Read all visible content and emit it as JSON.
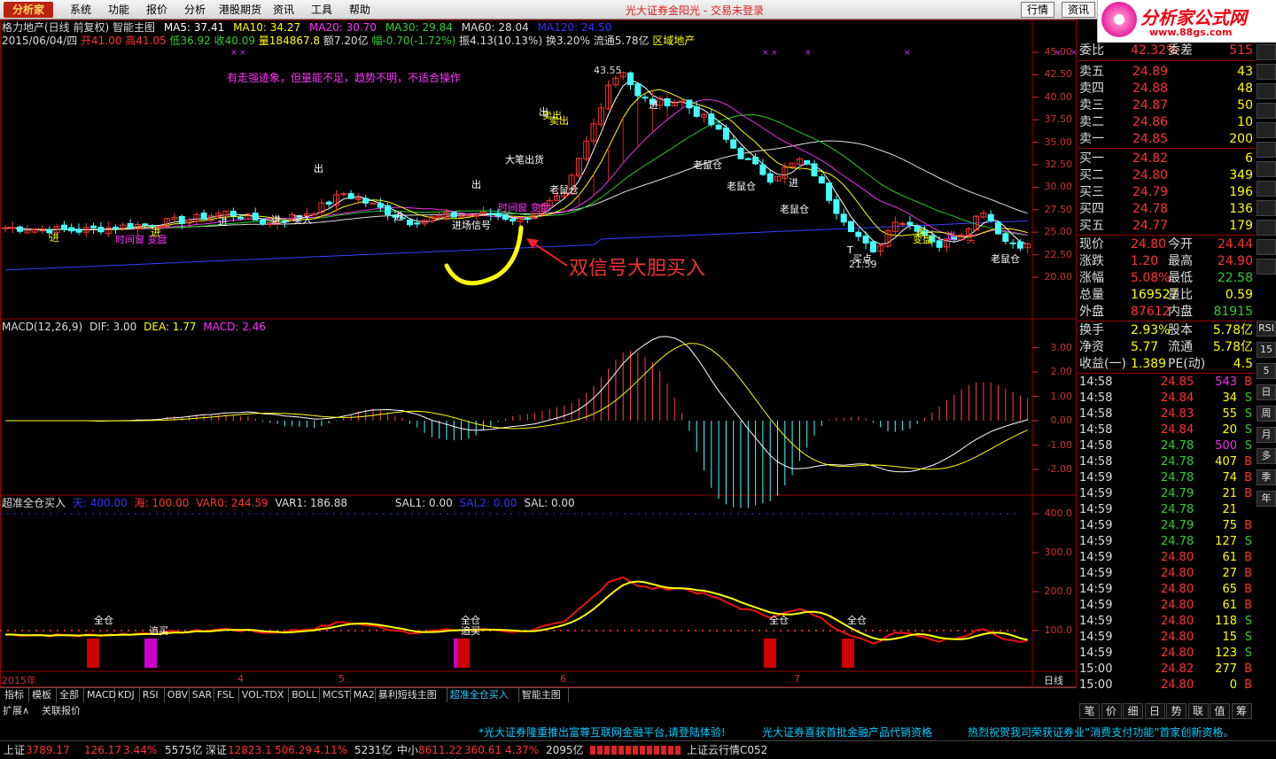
{
  "app": {
    "logo_text": "分析家",
    "title": "光大证券金阳光 - 交易未登录"
  },
  "menu": [
    "系统",
    "功能",
    "报价",
    "分析",
    "港股期货",
    "资讯",
    "工具",
    "帮助"
  ],
  "top_buttons": {
    "quote": "行情",
    "info": "资讯"
  },
  "ad": {
    "title": "分析家公式网",
    "url": "www.88gs.com"
  },
  "header": {
    "line1": {
      "stock": "格力地产(日线 前复权) 智能主图",
      "ma5": "MA5: 37.41",
      "ma10": "MA10: 34.27",
      "ma20": "MA20: 30.70",
      "ma30": "MA30: 29.84",
      "ma60": "MA60: 28.04",
      "ma120": "MA120: 24.50"
    },
    "line2": {
      "date": "2015/06/04/四",
      "open": "开41.00",
      "high": "高41.05",
      "low": "低36.92",
      "close": "收40.09",
      "vol": "量184867.8",
      "amt": "额7.20亿",
      "chg": "幅-0.70(-1.72%)",
      "amp": "振4.13(10.13%)",
      "turn": "换3.20%",
      "float": "流通5.78亿",
      "sector": "区域地产"
    }
  },
  "annotations": {
    "hint": "有走强迹象，但量能不足，趋势不明，不适合操作",
    "big": "双信号大胆买入",
    "high_price": "43.55",
    "low_price": "21.59",
    "labels": [
      "进",
      "时间窗 变盘",
      "进",
      "买入",
      "出",
      "进",
      "进",
      "进",
      "进场信号",
      "时间窗 变盘",
      "出",
      "大笔出货",
      "卖出",
      "出",
      "进",
      "老鼠仓",
      "老鼠仓",
      "老鼠仓",
      "老鼠仓",
      "买点",
      "进",
      "进",
      "变盘",
      "买",
      "老鼠仓",
      "卖出",
      "进",
      "T"
    ]
  },
  "price_axis": [
    "45.00",
    "42.50",
    "40.00",
    "37.50",
    "35.00",
    "32.50",
    "30.00",
    "27.50",
    "25.00",
    "22.50",
    "20.00"
  ],
  "macd": {
    "title": "MACD(12,26,9)",
    "dif": "DIF: 3.00",
    "dea": "DEA: 1.77",
    "macd": "MACD: 2.46",
    "axis": [
      "3.00",
      "2.00",
      "1.00",
      "0.00",
      "-1.00",
      "-2.00"
    ]
  },
  "ind3": {
    "title": "超准全仓买入",
    "tian": "天: 400.00",
    "hai": "海: 100.00",
    "var0": "VAR0: 244.59",
    "var1": "VAR1: 186.88",
    "sal1": "SAL1: 0.00",
    "sal2": "SAL2: 0.00",
    "sal": "SAL: 0.00",
    "axis": [
      "400.0",
      "300.0",
      "200.0",
      "100.0"
    ],
    "marks": [
      "全仓",
      "追买",
      "全仓",
      "追买",
      "全仓",
      "全仓"
    ]
  },
  "date_axis": {
    "year": "2015年",
    "months": [
      "4",
      "5",
      "6",
      "7"
    ],
    "period": "日线"
  },
  "panel": {
    "weibi": {
      "label": "委比",
      "value": "42.32%",
      "label2": "委差",
      "value2": "515"
    },
    "sells": [
      {
        "label": "卖五",
        "price": "24.89",
        "vol": "43"
      },
      {
        "label": "卖四",
        "price": "24.88",
        "vol": "48"
      },
      {
        "label": "卖三",
        "price": "24.87",
        "vol": "50"
      },
      {
        "label": "卖二",
        "price": "24.86",
        "vol": "10"
      },
      {
        "label": "卖一",
        "price": "24.85",
        "vol": "200"
      }
    ],
    "buys": [
      {
        "label": "买一",
        "price": "24.82",
        "vol": "6"
      },
      {
        "label": "买二",
        "price": "24.80",
        "vol": "349"
      },
      {
        "label": "买三",
        "price": "24.79",
        "vol": "196"
      },
      {
        "label": "买四",
        "price": "24.78",
        "vol": "136"
      },
      {
        "label": "买五",
        "price": "24.77",
        "vol": "179"
      }
    ],
    "stats": [
      {
        "l1": "现价",
        "v1": "24.80",
        "l2": "今开",
        "v2": "24.44"
      },
      {
        "l1": "涨跌",
        "v1": "1.20",
        "l2": "最高",
        "v2": "24.90"
      },
      {
        "l1": "涨幅",
        "v1": "5.08%",
        "l2": "最低",
        "v2": "22.58"
      },
      {
        "l1": "总量",
        "v1": "169527",
        "l2": "量比",
        "v2": "0.59"
      },
      {
        "l1": "外盘",
        "v1": "87612",
        "l2": "内盘",
        "v2": "81915"
      }
    ],
    "stats2": [
      {
        "l1": "换手",
        "v1": "2.93%",
        "l2": "股本",
        "v2": "5.78亿"
      },
      {
        "l1": "净资",
        "v1": "5.77",
        "l2": "流通",
        "v2": "5.78亿"
      },
      {
        "l1": "收益(一)",
        "v1": "1.389",
        "l2": "PE(动)",
        "v2": "4.5"
      }
    ],
    "ticks": [
      {
        "t": "14:58",
        "p": "24.85",
        "v": "543",
        "s": "B"
      },
      {
        "t": "14:58",
        "p": "24.84",
        "v": "34",
        "s": "S"
      },
      {
        "t": "14:58",
        "p": "24.83",
        "v": "55",
        "s": "S"
      },
      {
        "t": "14:58",
        "p": "24.84",
        "v": "20",
        "s": "S"
      },
      {
        "t": "14:58",
        "p": "24.78",
        "v": "500",
        "s": "S"
      },
      {
        "t": "14:58",
        "p": "24.78",
        "v": "407",
        "s": "B"
      },
      {
        "t": "14:59",
        "p": "24.78",
        "v": "74",
        "s": "B"
      },
      {
        "t": "14:59",
        "p": "24.79",
        "v": "21",
        "s": "B"
      },
      {
        "t": "14:59",
        "p": "24.78",
        "v": "21",
        "s": ""
      },
      {
        "t": "14:59",
        "p": "24.79",
        "v": "75",
        "s": "B"
      },
      {
        "t": "14:59",
        "p": "24.78",
        "v": "127",
        "s": "S"
      },
      {
        "t": "14:59",
        "p": "24.80",
        "v": "61",
        "s": "B"
      },
      {
        "t": "14:59",
        "p": "24.80",
        "v": "27",
        "s": "B"
      },
      {
        "t": "14:59",
        "p": "24.80",
        "v": "65",
        "s": "B"
      },
      {
        "t": "14:59",
        "p": "24.80",
        "v": "61",
        "s": "B"
      },
      {
        "t": "14:59",
        "p": "24.80",
        "v": "118",
        "s": "S"
      },
      {
        "t": "14:59",
        "p": "24.80",
        "v": "15",
        "s": "S"
      },
      {
        "t": "14:59",
        "p": "24.80",
        "v": "123",
        "s": "S"
      },
      {
        "t": "15:00",
        "p": "24.82",
        "v": "277",
        "s": "B"
      },
      {
        "t": "15:00",
        "p": "24.80",
        "v": "0",
        "s": "B"
      }
    ],
    "bottom_tabs": [
      "笔",
      "价",
      "细",
      "日",
      "势",
      "联",
      "值",
      "筹"
    ]
  },
  "side_buttons": [
    "RSI",
    "15",
    "5",
    "日",
    "周",
    "月",
    "多",
    "季",
    "年"
  ],
  "tabs": [
    "指标",
    "模板",
    "全部",
    "MACD",
    "KDJ",
    "RSI",
    "OBV",
    "SAR",
    "FSL",
    "VOL-TDX",
    "BOLL",
    "MCST",
    "MA2",
    "暴利短线主图",
    "超准全仓买入",
    "智能主图"
  ],
  "row2": [
    "扩展∧",
    "关联报价"
  ],
  "ticker": [
    "*光大证券隆重推出富尊互联网金融平台,请登陆体验!",
    "光大证券喜获首批金融产品代销资格",
    "热烈祝贺我司荣获证券业“消费支付功能”首家创新资格。"
  ],
  "status": {
    "sh": {
      "name": "上证",
      "v": "3789.17",
      "c": "126.17",
      "p": "3.44%",
      "a": "5575亿"
    },
    "sz": {
      "name": "深证",
      "v": "12823.1",
      "c": "506.29",
      "p": "4.11%",
      "a": "5231亿"
    },
    "zx": {
      "name": "中小",
      "v": "8611.22",
      "c": "360.61",
      "p": "4.37%",
      "a": "2095亿"
    },
    "cloud": "上证云行情C052"
  }
}
